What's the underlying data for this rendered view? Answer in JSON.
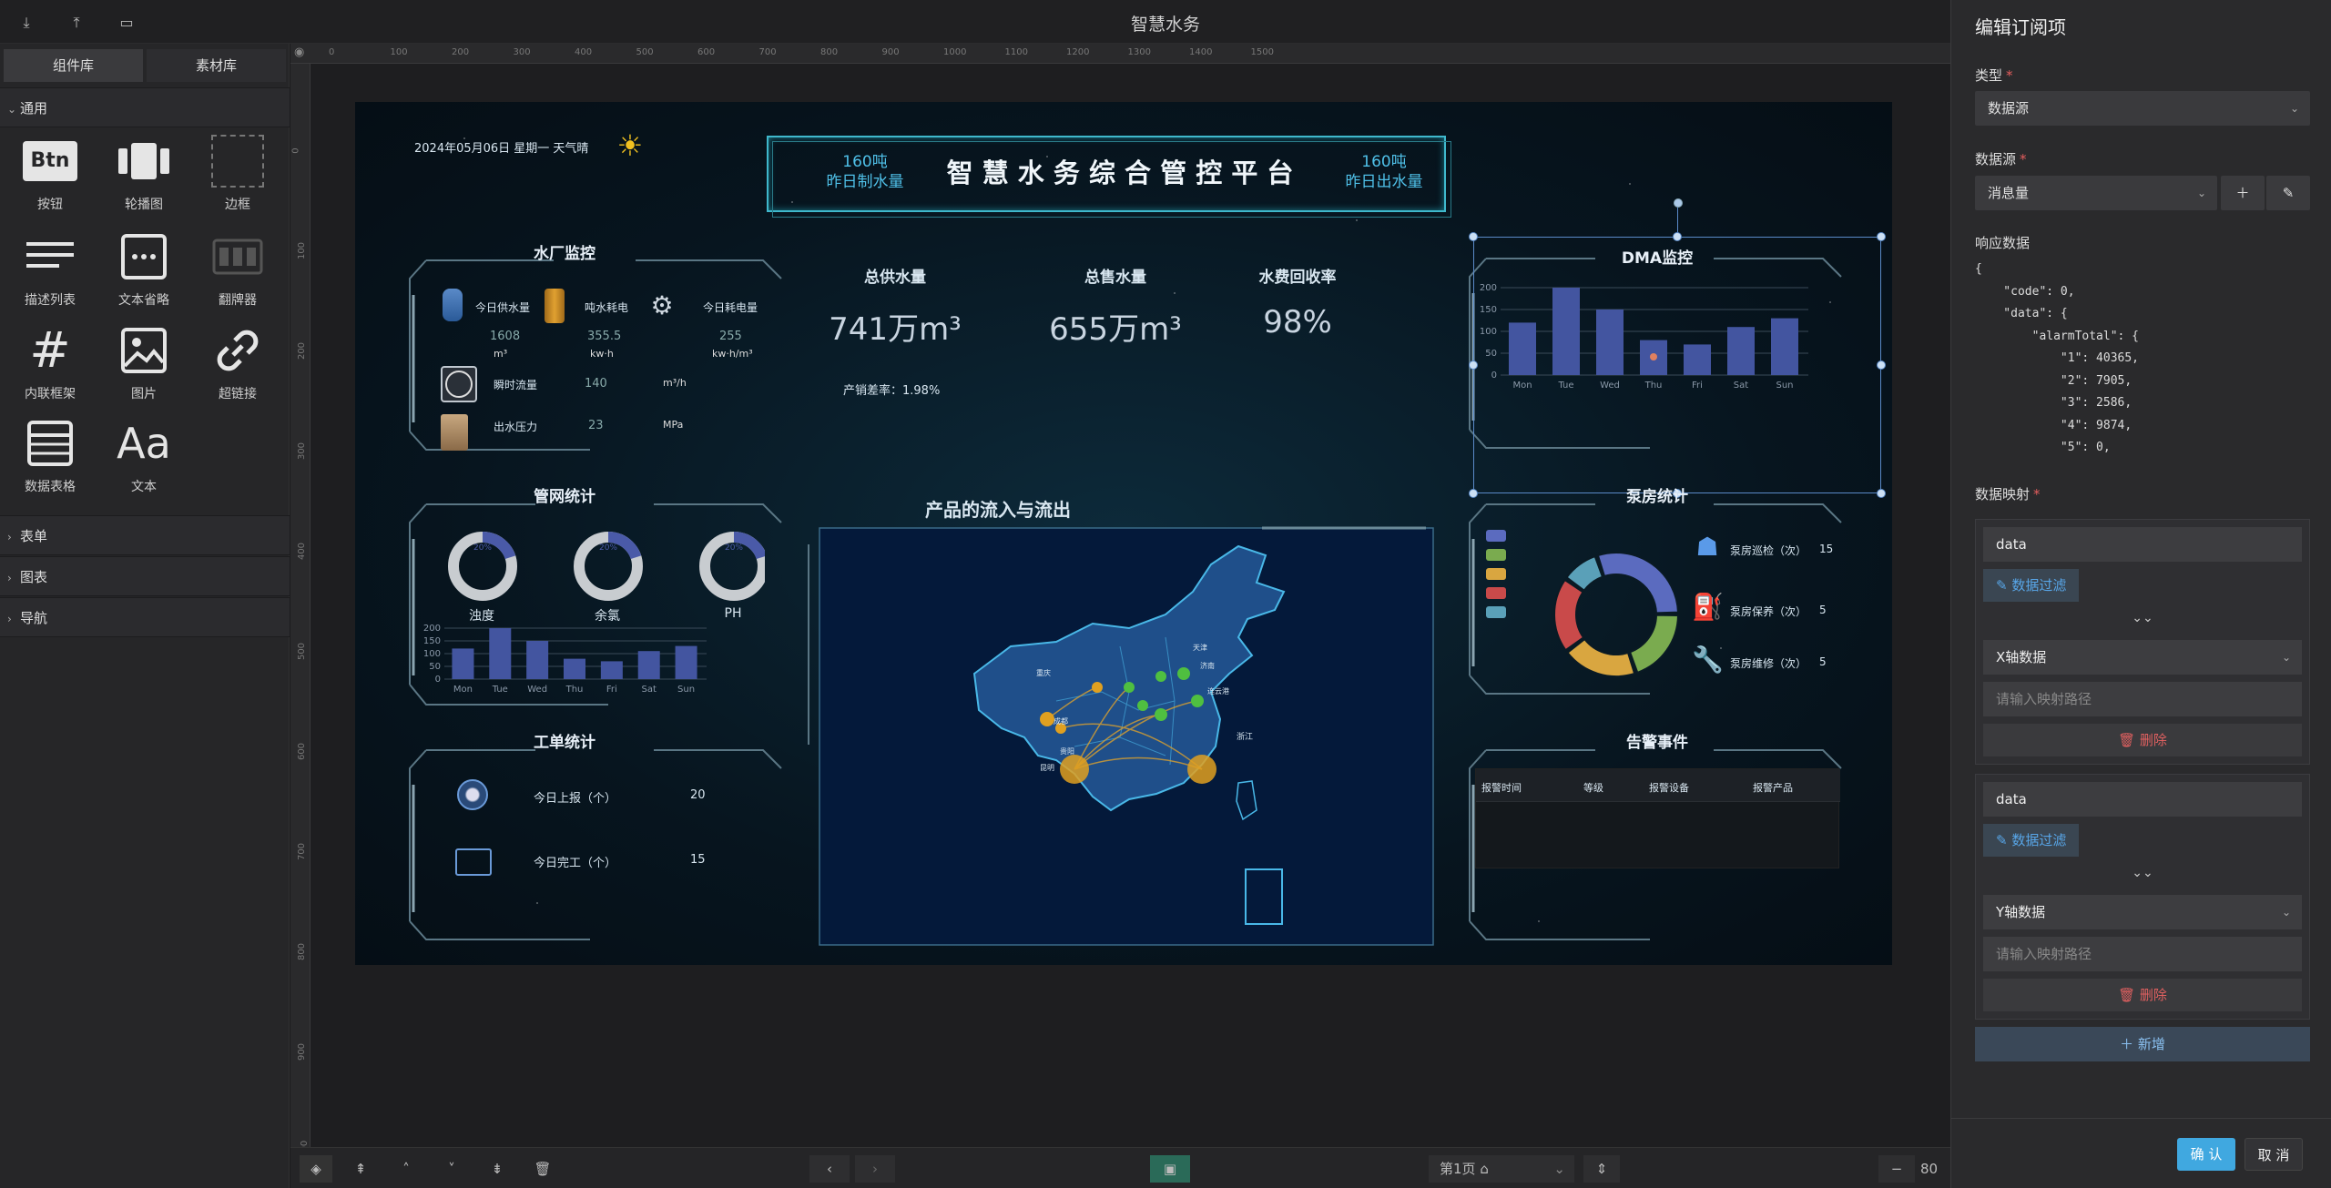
{
  "app_title": "智慧水务",
  "left": {
    "tabs": [
      "组件库",
      "素材库"
    ],
    "cat_general": "通用",
    "components": [
      "按钮",
      "轮播图",
      "边框",
      "描述列表",
      "文本省略",
      "翻牌器",
      "内联框架",
      "图片",
      "超链接",
      "数据表格",
      "文本"
    ],
    "btn_glyph": "Btn",
    "text_glyph": "Aa",
    "cats_collapsed": [
      "表单",
      "图表",
      "导航"
    ]
  },
  "ruler": {
    "top": [
      "0",
      "100",
      "200",
      "300",
      "400",
      "500",
      "600",
      "700",
      "800",
      "900",
      "1000",
      "1100",
      "1200",
      "1300",
      "1400",
      "1500"
    ],
    "left": [
      "0",
      "100",
      "200",
      "300",
      "400",
      "500",
      "600",
      "700",
      "800",
      "900",
      "1000"
    ]
  },
  "dash": {
    "date": "2024年05月06日 星期一 天气晴",
    "title": "智 慧 水 务 综 合 管 控 平 台",
    "left_stat": {
      "value": "160吨",
      "label": "昨日制水量"
    },
    "right_stat": {
      "value": "160吨",
      "label": "昨日出水量"
    },
    "plant": {
      "title": "水厂监控",
      "items": [
        {
          "name": "今日供水量",
          "value": "1608",
          "unit": "m³"
        },
        {
          "name": "吨水耗电",
          "value": "355.5",
          "unit": "kw·h"
        },
        {
          "name": "今日耗电量",
          "value": "255",
          "unit": "kw·h/m³"
        },
        {
          "name": "瞬时流量",
          "value": "140",
          "unit": "m³/h"
        },
        {
          "name": "出水压力",
          "value": "23",
          "unit": "MPa"
        }
      ]
    },
    "kpis": [
      {
        "label": "总供水量",
        "value": "741万m³"
      },
      {
        "label": "总售水量",
        "value": "655万m³"
      },
      {
        "label": "水费回收率",
        "value": "98%"
      }
    ],
    "diff": "产销差率：1.98%",
    "pipe": {
      "title": "管网统计",
      "gauges": [
        {
          "label": "浊度",
          "pct": "20%",
          "fraction": 0.2
        },
        {
          "label": "余氯",
          "pct": "20%",
          "fraction": 0.2
        },
        {
          "label": "PH",
          "pct": "20%",
          "fraction": 0.2
        }
      ],
      "days": [
        "Mon",
        "Tue",
        "Wed",
        "Thu",
        "Fri",
        "Sat",
        "Sun"
      ],
      "yticks": [
        "200",
        "150",
        "100",
        "50",
        "0"
      ]
    },
    "map_title": "产品的流入与流出",
    "map_cities": [
      "成都",
      "重庆",
      "贵阳",
      "昆明",
      "浙江",
      "连云港",
      "济南",
      "天津"
    ],
    "orders": {
      "title": "工单统计",
      "items": [
        {
          "label": "今日上报（个）",
          "value": "20"
        },
        {
          "label": "今日完工（个）",
          "value": "15"
        }
      ]
    },
    "dma": {
      "title": "DMA监控",
      "days": [
        "Mon",
        "Tue",
        "Wed",
        "Thu",
        "Fri",
        "Sat",
        "Sun"
      ],
      "yticks": [
        "200",
        "150",
        "100",
        "50",
        "0"
      ]
    },
    "pump": {
      "title": "泵房统计",
      "items": [
        {
          "label": "泵房巡检（次）",
          "value": "15"
        },
        {
          "label": "泵房保养（次）",
          "value": "5"
        },
        {
          "label": "泵房维修（次）",
          "value": "5"
        }
      ],
      "legend_colors": [
        "#5b6bbf",
        "#7aab4f",
        "#d9a640",
        "#c94a4a",
        "#5aa0b8"
      ]
    },
    "alarm": {
      "title": "告警事件",
      "headers": [
        "报警时间",
        "等级",
        "报警设备",
        "报警产品"
      ]
    }
  },
  "chart_data": [
    {
      "type": "bar",
      "title": "DMA监控",
      "categories": [
        "Mon",
        "Tue",
        "Wed",
        "Thu",
        "Fri",
        "Sat",
        "Sun"
      ],
      "values": [
        120,
        200,
        150,
        80,
        70,
        110,
        130
      ],
      "ylim": [
        0,
        200
      ],
      "color": "#4355a0"
    },
    {
      "type": "bar",
      "title": "管网统计",
      "categories": [
        "Mon",
        "Tue",
        "Wed",
        "Thu",
        "Fri",
        "Sat",
        "Sun"
      ],
      "values": [
        120,
        200,
        150,
        80,
        70,
        110,
        130
      ],
      "ylim": [
        0,
        200
      ],
      "color": "#4355a0"
    },
    {
      "type": "pie",
      "title": "泵房统计",
      "values": [
        30,
        20,
        20,
        20,
        10
      ],
      "colors": [
        "#5b6bbf",
        "#7aab4f",
        "#d9a640",
        "#c94a4a",
        "#5aa0b8"
      ]
    }
  ],
  "bottom": {
    "page": "第1页",
    "zoom": "80"
  },
  "right": {
    "title": "编辑订阅项",
    "type_label": "类型",
    "type_value": "数据源",
    "source_label": "数据源",
    "source_value": "消息量",
    "response_label": "响应数据",
    "code": [
      "{",
      "    \"code\": 0,",
      "    \"data\": {",
      "        \"alarmTotal\": {",
      "            \"1\": 40365,",
      "            \"2\": 7905,",
      "            \"3\": 2586,",
      "            \"4\": 9874,",
      "            \"5\": 0,"
    ],
    "mapping_label": "数据映射",
    "maps": [
      {
        "key": "data",
        "filter": "数据过滤",
        "axis": "X轴数据",
        "placeholder": "请输入映射路径",
        "delete": "删除"
      },
      {
        "key": "data",
        "filter": "数据过滤",
        "axis": "Y轴数据",
        "placeholder": "请输入映射路径",
        "delete": "删除"
      }
    ],
    "add": "新增",
    "confirm": "确 认",
    "cancel": "取 消"
  }
}
